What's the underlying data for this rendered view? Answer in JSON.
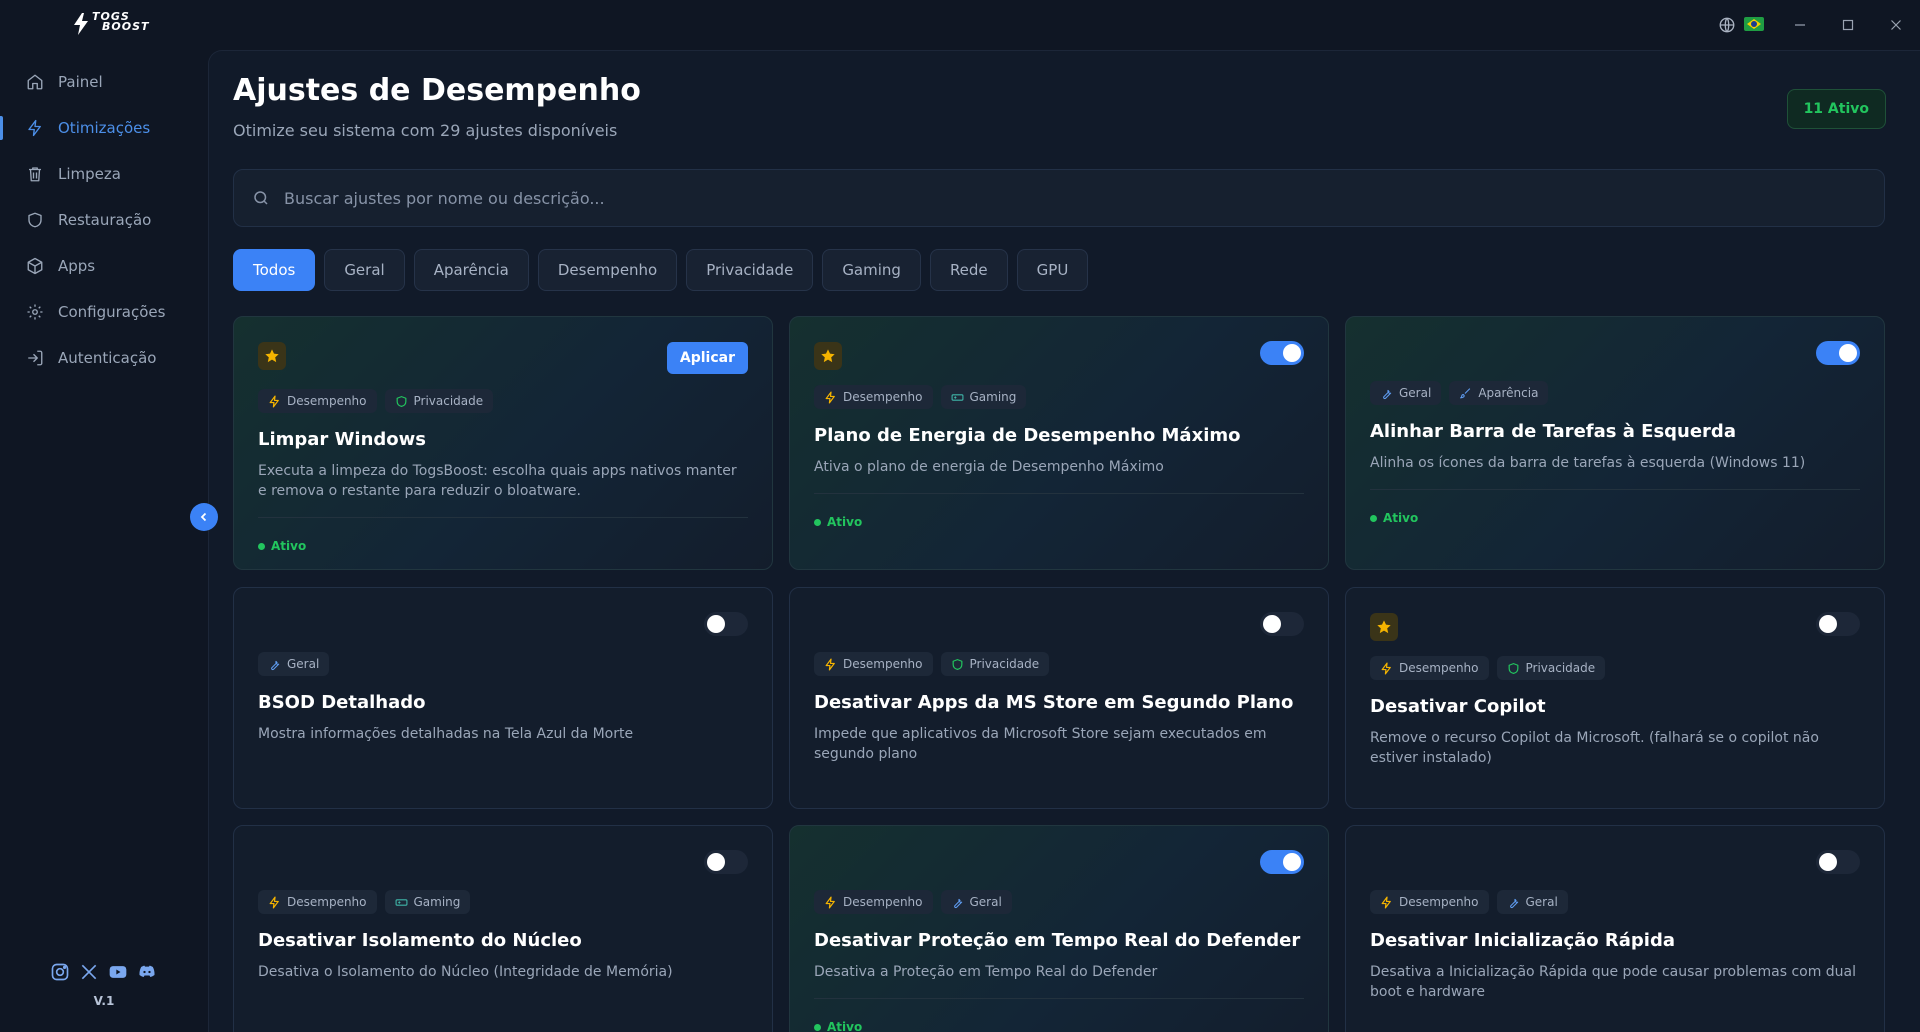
{
  "app": {
    "logo_text_line1": "TOGS",
    "logo_text_line2": "BOOST",
    "version": "V.1",
    "colors": {
      "accent": "#3b82f6",
      "success": "#22c55e",
      "star": "#f5b400",
      "background": "#0f1623"
    }
  },
  "sidebar": {
    "items": [
      {
        "label": "Painel",
        "icon": "home-icon"
      },
      {
        "label": "Otimizações",
        "icon": "lightning-icon",
        "active": true
      },
      {
        "label": "Limpeza",
        "icon": "trash-icon"
      },
      {
        "label": "Restauração",
        "icon": "shield-icon"
      },
      {
        "label": "Apps",
        "icon": "package-icon"
      },
      {
        "label": "Configurações",
        "icon": "gear-icon"
      },
      {
        "label": "Autenticação",
        "icon": "login-icon"
      }
    ],
    "socials": [
      "instagram-icon",
      "x-icon",
      "youtube-icon",
      "discord-icon"
    ]
  },
  "header": {
    "title": "Ajustes de Desempenho",
    "subtitle": "Otimize seu sistema com 29 ajustes disponíveis",
    "active_badge": "11 Ativo"
  },
  "search": {
    "placeholder": "Buscar ajustes por nome ou descrição..."
  },
  "filters": [
    "Todos",
    "Geral",
    "Aparência",
    "Desempenho",
    "Privacidade",
    "Gaming",
    "Rede",
    "GPU"
  ],
  "cards": [
    {
      "title": "Limpar Windows",
      "description": "Executa a limpeza do TogsBoost: escolha quais apps nativos manter e remova o restante para reduzir o bloatware.",
      "tags": [
        "Desempenho",
        "Privacidade"
      ],
      "starred": true,
      "action_label": "Aplicar",
      "status": "Ativo",
      "enabled": true
    },
    {
      "title": "Plano de Energia de Desempenho Máximo",
      "description": "Ativa o plano de energia de Desempenho Máximo",
      "tags": [
        "Desempenho",
        "Gaming"
      ],
      "starred": true,
      "status": "Ativo",
      "enabled": true
    },
    {
      "title": "Alinhar Barra de Tarefas à Esquerda",
      "description": "Alinha os ícones da barra de tarefas à esquerda (Windows 11)",
      "tags": [
        "Geral",
        "Aparência"
      ],
      "starred": false,
      "status": "Ativo",
      "enabled": true
    },
    {
      "title": "BSOD Detalhado",
      "description": "Mostra informações detalhadas na Tela Azul da Morte",
      "tags": [
        "Geral"
      ],
      "starred": false,
      "enabled": false
    },
    {
      "title": "Desativar Apps da MS Store em Segundo Plano",
      "description": "Impede que aplicativos da Microsoft Store sejam executados em segundo plano",
      "tags": [
        "Desempenho",
        "Privacidade"
      ],
      "starred": false,
      "enabled": false
    },
    {
      "title": "Desativar Copilot",
      "description": "Remove o recurso Copilot da Microsoft. (falhará se o copilot não estiver instalado)",
      "tags": [
        "Desempenho",
        "Privacidade"
      ],
      "starred": true,
      "enabled": false
    },
    {
      "title": "Desativar Isolamento do Núcleo",
      "description": "Desativa o Isolamento do Núcleo (Integridade de Memória)",
      "tags": [
        "Desempenho",
        "Gaming"
      ],
      "starred": false,
      "enabled": false
    },
    {
      "title": "Desativar Proteção em Tempo Real do Defender",
      "description": "Desativa a Proteção em Tempo Real do Defender",
      "tags": [
        "Desempenho",
        "Geral"
      ],
      "starred": false,
      "status": "Ativo",
      "enabled": true
    },
    {
      "title": "Desativar Inicialização Rápida",
      "description": "Desativa a Inicialização Rápida que pode causar problemas com dual boot e hardware",
      "tags": [
        "Desempenho",
        "Geral"
      ],
      "starred": false,
      "enabled": false
    }
  ]
}
